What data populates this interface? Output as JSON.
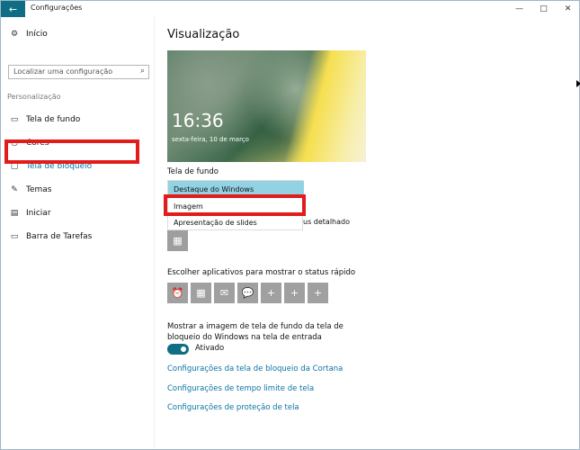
{
  "window": {
    "title": "Configurações",
    "back_icon": "←",
    "minimize_icon": "—",
    "maximize_icon": "□",
    "close_icon": "✕"
  },
  "sidebar": {
    "home": {
      "label": "Início",
      "icon": "⚙"
    },
    "search": {
      "placeholder": "Localizar uma configuração",
      "icon": "⌕"
    },
    "section": "Personalização",
    "items": [
      {
        "label": "Tela de fundo",
        "icon": "▭"
      },
      {
        "label": "Cores",
        "icon": "◔"
      },
      {
        "label": "Tela de bloqueio",
        "icon": "▢"
      },
      {
        "label": "Temas",
        "icon": "✎"
      },
      {
        "label": "Iniciar",
        "icon": "▤"
      },
      {
        "label": "Barra de Tarefas",
        "icon": "▭"
      }
    ]
  },
  "main": {
    "title": "Visualização",
    "preview": {
      "time": "16:36",
      "date": "sexta-feira, 10 de março"
    },
    "background_label": "Tela de fundo",
    "dropdown_options": [
      "Destaque do Windows",
      "Imagem",
      "Apresentação de slides"
    ],
    "selected_option": "Destaque do Windows",
    "detail_suffix": "us detalhado",
    "calendar_icon": "▦",
    "quick_status_label": "Escolher aplicativos para mostrar o status rápido",
    "quick_status_icons": [
      "⏰",
      "▦",
      "✉",
      "💬",
      "+",
      "+",
      "+"
    ],
    "show_background_text": "Mostrar a imagem de tela de fundo da tela de bloqueio do Windows na tela de entrada",
    "toggle_label": "Ativado",
    "links": [
      "Configurações da tela de bloqueio da Cortana",
      "Configurações de tempo limite de tela",
      "Configurações de proteção de tela"
    ]
  }
}
